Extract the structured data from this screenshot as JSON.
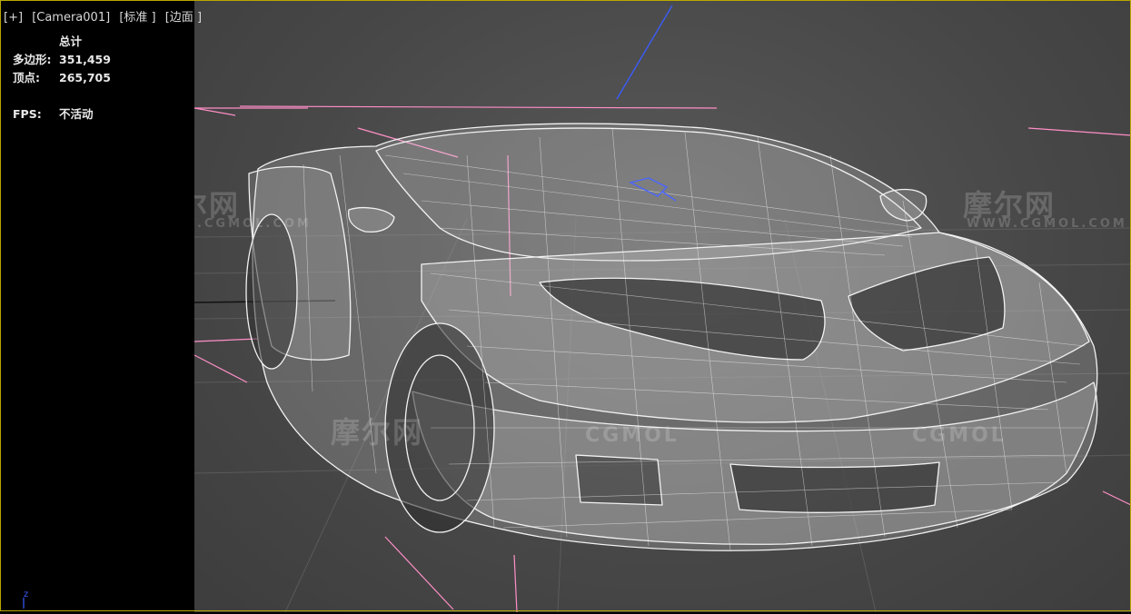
{
  "viewport": {
    "label_plus": "[+]",
    "label_camera": "[Camera001]",
    "label_shading": "[标准 ]",
    "label_mode": "[边面 ]"
  },
  "stats": {
    "title": "总计",
    "polygons_label": "多边形:",
    "polygons_value": "351,459",
    "vertices_label": "顶点:",
    "vertices_value": "265,705",
    "fps_label": "FPS:",
    "fps_value": "不活动"
  },
  "gizmo": {
    "z_label": "z"
  },
  "watermarks": {
    "cn": "摩尔网",
    "en": "WWW.CGMOL.COM",
    "logo": "CGMOL"
  },
  "colors": {
    "viewport_border": "#d8c200",
    "wire": "#ffffff",
    "camera_guides": "#ff7fbf",
    "z_axis": "#3a5cff"
  }
}
